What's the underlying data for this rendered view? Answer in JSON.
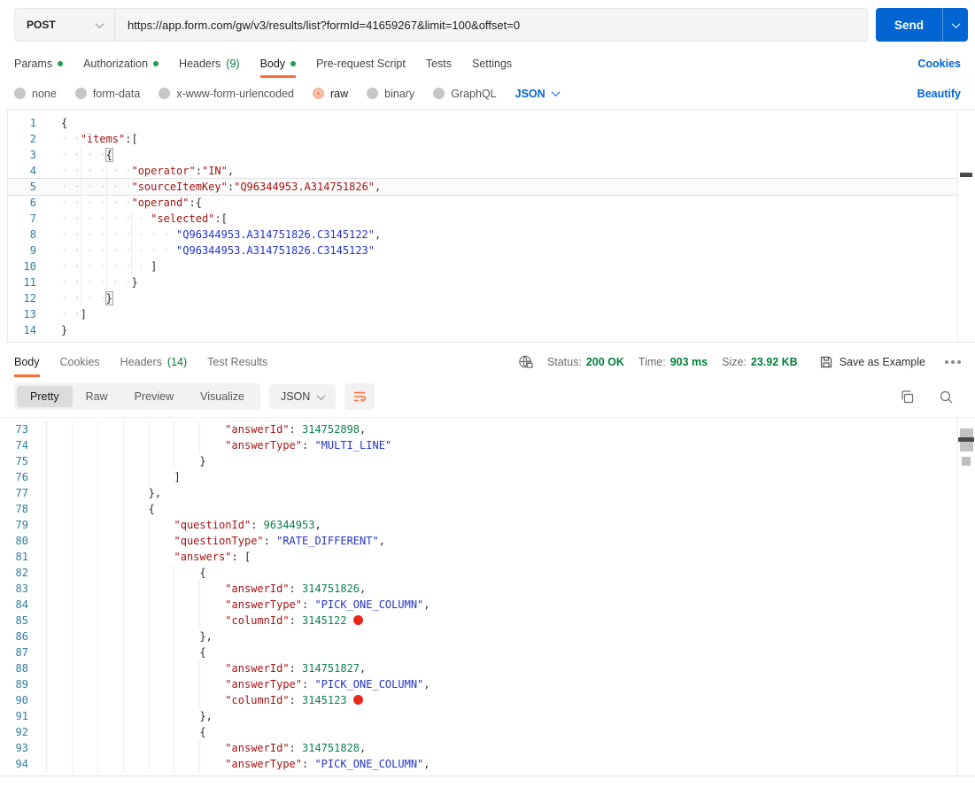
{
  "colors": {
    "accent": "#FF6C37",
    "link": "#0265D2",
    "send_bg": "#0265D2",
    "status_green": "#007E3A",
    "tab_dot_green": "#1AA053",
    "code_key": "#A31515",
    "code_string": "#2433CC",
    "code_number": "#0C7F4D",
    "line_number": "#2F7E9E",
    "annotation_red": "#E8271A"
  },
  "request_bar": {
    "method": "POST",
    "url": "https://app.form.com/gw/v3/results/list?formId=41659267&limit=100&offset=0",
    "send_label": "Send"
  },
  "request_tabs": {
    "items": [
      {
        "label": "Params",
        "dot": true
      },
      {
        "label": "Authorization",
        "dot": true
      },
      {
        "label": "Headers",
        "count": "(9)"
      },
      {
        "label": "Body",
        "dot": true,
        "active": true
      },
      {
        "label": "Pre-request Script"
      },
      {
        "label": "Tests"
      },
      {
        "label": "Settings"
      }
    ],
    "cookies_link": "Cookies"
  },
  "body_type": {
    "options": [
      {
        "label": "none"
      },
      {
        "label": "form-data"
      },
      {
        "label": "x-www-form-urlencoded"
      },
      {
        "label": "raw",
        "selected": true
      },
      {
        "label": "binary"
      },
      {
        "label": "GraphQL"
      }
    ],
    "language": "JSON",
    "beautify_label": "Beautify"
  },
  "request_editor": {
    "lines": [
      {
        "n": 1,
        "ind": 0,
        "guides": [],
        "segs": [
          [
            "p",
            "{"
          ]
        ]
      },
      {
        "n": 2,
        "ind": 3,
        "guides": [],
        "segs": [
          [
            "k",
            "\"items\""
          ],
          [
            "p",
            ":["
          ]
        ]
      },
      {
        "n": 3,
        "ind": 7,
        "guides": [
          3
        ],
        "segs": [
          [
            "b",
            "{"
          ]
        ]
      },
      {
        "n": 4,
        "ind": 11,
        "guides": [
          3,
          7
        ],
        "segs": [
          [
            "k",
            "\"operator\""
          ],
          [
            "p",
            ":"
          ],
          [
            "k",
            "\"IN\""
          ],
          [
            "p",
            ","
          ]
        ]
      },
      {
        "n": 5,
        "ind": 11,
        "guides": [
          3,
          7
        ],
        "active": true,
        "segs": [
          [
            "k",
            "\"sourceItemKey\""
          ],
          [
            "p",
            ":"
          ],
          [
            "k",
            "\"Q96344953.A314751826\""
          ],
          [
            "p",
            ","
          ]
        ]
      },
      {
        "n": 6,
        "ind": 11,
        "guides": [
          3,
          7
        ],
        "segs": [
          [
            "k",
            "\"operand\""
          ],
          [
            "p",
            ":{"
          ]
        ]
      },
      {
        "n": 7,
        "ind": 14,
        "guides": [
          3,
          7,
          11
        ],
        "segs": [
          [
            "k",
            "\"selected\""
          ],
          [
            "p",
            ":["
          ]
        ]
      },
      {
        "n": 8,
        "ind": 18,
        "guides": [
          3,
          7,
          11
        ],
        "segs": [
          [
            "s",
            "\"Q96344953.A314751826.C3145122\""
          ],
          [
            "p",
            ","
          ]
        ]
      },
      {
        "n": 9,
        "ind": 18,
        "guides": [
          3,
          7,
          11
        ],
        "segs": [
          [
            "s",
            "\"Q96344953.A314751826.C3145123\""
          ]
        ]
      },
      {
        "n": 10,
        "ind": 14,
        "guides": [
          3,
          7,
          11
        ],
        "segs": [
          [
            "p",
            "]"
          ]
        ]
      },
      {
        "n": 11,
        "ind": 11,
        "guides": [
          3,
          7
        ],
        "segs": [
          [
            "p",
            "}"
          ]
        ]
      },
      {
        "n": 12,
        "ind": 7,
        "guides": [
          3
        ],
        "segs": [
          [
            "b",
            "}"
          ]
        ]
      },
      {
        "n": 13,
        "ind": 3,
        "guides": [],
        "segs": [
          [
            "p",
            "]"
          ]
        ]
      },
      {
        "n": 14,
        "ind": 0,
        "guides": [],
        "segs": [
          [
            "p",
            "}"
          ]
        ]
      }
    ]
  },
  "response_tabs": {
    "items": [
      {
        "label": "Body",
        "active": true
      },
      {
        "label": "Cookies"
      },
      {
        "label": "Headers",
        "count": "(14)"
      },
      {
        "label": "Test Results"
      }
    ]
  },
  "response_meta": {
    "status_label": "Status:",
    "status_value": "200 OK",
    "time_label": "Time:",
    "time_value": "903 ms",
    "size_label": "Size:",
    "size_value": "23.92 KB",
    "save_label": "Save as Example"
  },
  "response_viewbar": {
    "views": [
      {
        "label": "Pretty",
        "selected": true
      },
      {
        "label": "Raw"
      },
      {
        "label": "Preview"
      },
      {
        "label": "Visualize"
      }
    ],
    "language": "JSON"
  },
  "response_viewer": {
    "lines": [
      {
        "n": 73,
        "lvl": 7,
        "segs": [
          [
            "k",
            "\"answerId\""
          ],
          [
            "p",
            ": "
          ],
          [
            "num",
            "314752898"
          ],
          [
            "p",
            ","
          ]
        ]
      },
      {
        "n": 74,
        "lvl": 7,
        "segs": [
          [
            "k",
            "\"answerType\""
          ],
          [
            "p",
            ": "
          ],
          [
            "s",
            "\"MULTI_LINE\""
          ]
        ]
      },
      {
        "n": 75,
        "lvl": 6,
        "segs": [
          [
            "p",
            "}"
          ]
        ]
      },
      {
        "n": 76,
        "lvl": 5,
        "segs": [
          [
            "p",
            "]"
          ]
        ]
      },
      {
        "n": 77,
        "lvl": 4,
        "segs": [
          [
            "p",
            "},"
          ]
        ]
      },
      {
        "n": 78,
        "lvl": 4,
        "segs": [
          [
            "p",
            "{"
          ]
        ]
      },
      {
        "n": 79,
        "lvl": 5,
        "segs": [
          [
            "k",
            "\"questionId\""
          ],
          [
            "p",
            ": "
          ],
          [
            "num",
            "96344953"
          ],
          [
            "p",
            ","
          ]
        ]
      },
      {
        "n": 80,
        "lvl": 5,
        "segs": [
          [
            "k",
            "\"questionType\""
          ],
          [
            "p",
            ": "
          ],
          [
            "s",
            "\"RATE_DIFFERENT\""
          ],
          [
            "p",
            ","
          ]
        ]
      },
      {
        "n": 81,
        "lvl": 5,
        "segs": [
          [
            "k",
            "\"answers\""
          ],
          [
            "p",
            ": ["
          ]
        ]
      },
      {
        "n": 82,
        "lvl": 6,
        "segs": [
          [
            "p",
            "{"
          ]
        ]
      },
      {
        "n": 83,
        "lvl": 7,
        "segs": [
          [
            "k",
            "\"answerId\""
          ],
          [
            "p",
            ": "
          ],
          [
            "num",
            "314751826"
          ],
          [
            "p",
            ","
          ]
        ]
      },
      {
        "n": 84,
        "lvl": 7,
        "segs": [
          [
            "k",
            "\"answerType\""
          ],
          [
            "p",
            ": "
          ],
          [
            "s",
            "\"PICK_ONE_COLUMN\""
          ],
          [
            "p",
            ","
          ]
        ]
      },
      {
        "n": 85,
        "lvl": 7,
        "reddot": true,
        "segs": [
          [
            "k",
            "\"columnId\""
          ],
          [
            "p",
            ": "
          ],
          [
            "num",
            "3145122"
          ]
        ]
      },
      {
        "n": 86,
        "lvl": 6,
        "segs": [
          [
            "p",
            "},"
          ]
        ]
      },
      {
        "n": 87,
        "lvl": 6,
        "segs": [
          [
            "p",
            "{"
          ]
        ]
      },
      {
        "n": 88,
        "lvl": 7,
        "segs": [
          [
            "k",
            "\"answerId\""
          ],
          [
            "p",
            ": "
          ],
          [
            "num",
            "314751827"
          ],
          [
            "p",
            ","
          ]
        ]
      },
      {
        "n": 89,
        "lvl": 7,
        "segs": [
          [
            "k",
            "\"answerType\""
          ],
          [
            "p",
            ": "
          ],
          [
            "s",
            "\"PICK_ONE_COLUMN\""
          ],
          [
            "p",
            ","
          ]
        ]
      },
      {
        "n": 90,
        "lvl": 7,
        "reddot": true,
        "segs": [
          [
            "k",
            "\"columnId\""
          ],
          [
            "p",
            ": "
          ],
          [
            "num",
            "3145123"
          ]
        ]
      },
      {
        "n": 91,
        "lvl": 6,
        "segs": [
          [
            "p",
            "},"
          ]
        ]
      },
      {
        "n": 92,
        "lvl": 6,
        "segs": [
          [
            "p",
            "{"
          ]
        ]
      },
      {
        "n": 93,
        "lvl": 7,
        "segs": [
          [
            "k",
            "\"answerId\""
          ],
          [
            "p",
            ": "
          ],
          [
            "num",
            "314751828"
          ],
          [
            "p",
            ","
          ]
        ]
      },
      {
        "n": 94,
        "lvl": 7,
        "segs": [
          [
            "k",
            "\"answerType\""
          ],
          [
            "p",
            ": "
          ],
          [
            "s",
            "\"PICK_ONE_COLUMN\""
          ],
          [
            "p",
            ","
          ]
        ]
      }
    ]
  }
}
